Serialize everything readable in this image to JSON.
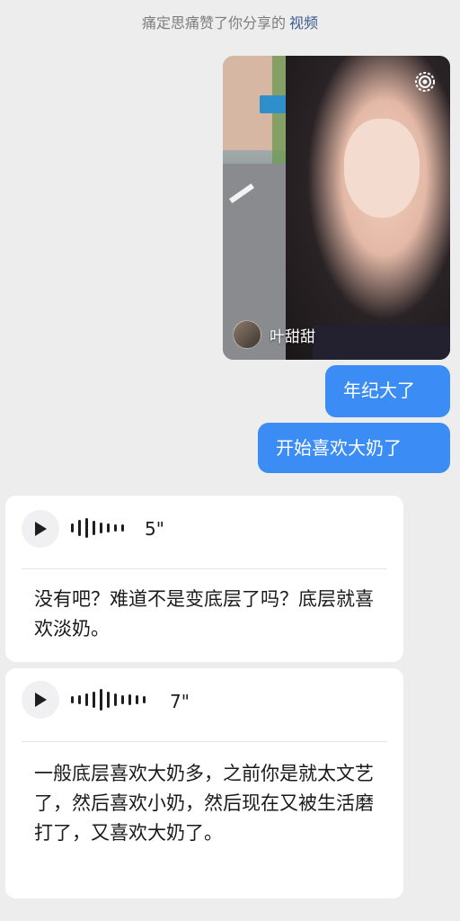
{
  "notice": {
    "text": "痛定思痛赞了你分享的",
    "link": "视频"
  },
  "video_card": {
    "author": "叶甜甜",
    "icon": "settings-ring-icon"
  },
  "messages_sent": [
    {
      "text": "年纪大了"
    },
    {
      "text": "开始喜欢大奶了"
    }
  ],
  "voice_messages": [
    {
      "duration": "5\"",
      "transcript": "没有吧？难道不是变底层了吗？底层就喜欢淡奶。"
    },
    {
      "duration": "7\"",
      "transcript": "一般底层喜欢大奶多，之前你是就太文艺了，然后喜欢小奶，然后现在又被生活磨打了，又喜欢大奶了。"
    }
  ],
  "colors": {
    "background": "#ededed",
    "sent_bubble": "#3b8cf4",
    "link": "#3b5b8a"
  }
}
